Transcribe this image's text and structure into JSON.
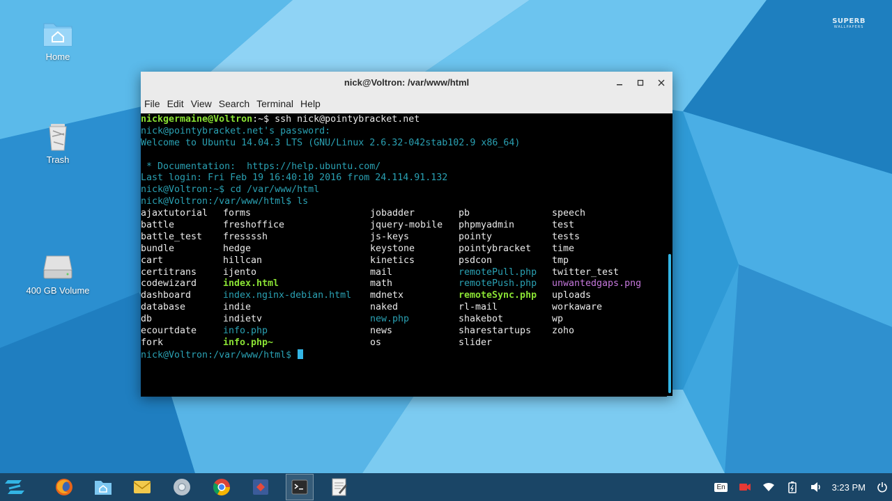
{
  "desktop": {
    "watermark": {
      "line1": "SUPERB",
      "line2": "WALLPAPERS"
    },
    "icons": [
      {
        "label": "Home",
        "icon": "home-folder-icon"
      },
      {
        "label": "Trash",
        "icon": "trash-icon"
      },
      {
        "label": "400 GB Volume",
        "icon": "drive-icon"
      }
    ]
  },
  "window": {
    "title": "nick@Voltron: /var/www/html",
    "menu": [
      "File",
      "Edit",
      "View",
      "Search",
      "Terminal",
      "Help"
    ]
  },
  "terminal": {
    "prompt1_user": "nickgermaine@Voltron",
    "prompt1_rest": ":~$ ssh nick@pointybracket.net",
    "line_password": "nick@pointybracket.net's password:",
    "line_welcome": "Welcome to Ubuntu 14.04.3 LTS (GNU/Linux 2.6.32-042stab102.9 x86_64)",
    "line_doc": " * Documentation:  https://help.ubuntu.com/",
    "line_lastlogin": "Last login: Fri Feb 19 16:40:10 2016 from 24.114.91.132",
    "line_cd": "nick@Voltron:~$ cd /var/www/html",
    "line_ls": "nick@Voltron:/var/www/html$ ls",
    "ls_columns": [
      [
        {
          "t": "ajaxtutorial",
          "c": "white"
        },
        {
          "t": "battle",
          "c": "white"
        },
        {
          "t": "battle_test",
          "c": "white"
        },
        {
          "t": "bundle",
          "c": "white"
        },
        {
          "t": "cart",
          "c": "white"
        },
        {
          "t": "certitrans",
          "c": "white"
        },
        {
          "t": "codewizard",
          "c": "white"
        },
        {
          "t": "dashboard",
          "c": "white"
        },
        {
          "t": "database",
          "c": "white"
        },
        {
          "t": "db",
          "c": "white"
        },
        {
          "t": "ecourtdate",
          "c": "white"
        },
        {
          "t": "fork",
          "c": "white"
        }
      ],
      [
        {
          "t": "forms",
          "c": "white"
        },
        {
          "t": "freshoffice",
          "c": "white"
        },
        {
          "t": "fressssh",
          "c": "white"
        },
        {
          "t": "hedge",
          "c": "white"
        },
        {
          "t": "hillcan",
          "c": "white"
        },
        {
          "t": "ijento",
          "c": "white"
        },
        {
          "t": "index.html",
          "c": "green-b"
        },
        {
          "t": "index.nginx-debian.html",
          "c": "cyan"
        },
        {
          "t": "indie",
          "c": "white"
        },
        {
          "t": "indietv",
          "c": "white"
        },
        {
          "t": "info.php",
          "c": "cyan"
        },
        {
          "t": "info.php~",
          "c": "green-b"
        }
      ],
      [
        {
          "t": "jobadder",
          "c": "white"
        },
        {
          "t": "jquery-mobile",
          "c": "white"
        },
        {
          "t": "js-keys",
          "c": "white"
        },
        {
          "t": "keystone",
          "c": "white"
        },
        {
          "t": "kinetics",
          "c": "white"
        },
        {
          "t": "mail",
          "c": "white"
        },
        {
          "t": "math",
          "c": "white"
        },
        {
          "t": "mdnetx",
          "c": "white"
        },
        {
          "t": "naked",
          "c": "white"
        },
        {
          "t": "new.php",
          "c": "cyan"
        },
        {
          "t": "news",
          "c": "white"
        },
        {
          "t": "os",
          "c": "white"
        }
      ],
      [
        {
          "t": "pb",
          "c": "white"
        },
        {
          "t": "phpmyadmin",
          "c": "white"
        },
        {
          "t": "pointy",
          "c": "white"
        },
        {
          "t": "pointybracket",
          "c": "white"
        },
        {
          "t": "psdcon",
          "c": "white"
        },
        {
          "t": "remotePull.php",
          "c": "cyan"
        },
        {
          "t": "remotePush.php",
          "c": "cyan"
        },
        {
          "t": "remoteSync.php",
          "c": "green-b"
        },
        {
          "t": "rl-mail",
          "c": "white"
        },
        {
          "t": "shakebot",
          "c": "white"
        },
        {
          "t": "sharestartups",
          "c": "white"
        },
        {
          "t": "slider",
          "c": "white"
        }
      ],
      [
        {
          "t": "speech",
          "c": "white"
        },
        {
          "t": "test",
          "c": "white"
        },
        {
          "t": "tests",
          "c": "white"
        },
        {
          "t": "time",
          "c": "white"
        },
        {
          "t": "tmp",
          "c": "white"
        },
        {
          "t": "twitter_test",
          "c": "white"
        },
        {
          "t": "unwantedgaps.png",
          "c": "magenta"
        },
        {
          "t": "uploads",
          "c": "white"
        },
        {
          "t": "workaware",
          "c": "white"
        },
        {
          "t": "wp",
          "c": "white"
        },
        {
          "t": "zoho",
          "c": "white"
        }
      ]
    ],
    "final_prompt": "nick@Voltron:/var/www/html$ "
  },
  "taskbar": {
    "apps": [
      "zorin-menu-icon",
      "firefox-icon",
      "files-icon",
      "mail-icon",
      "chromium-icon",
      "chrome-icon",
      "app-icon",
      "terminal-icon",
      "text-editor-icon"
    ],
    "tray": {
      "keyboard_layout": "En",
      "clock": "3:23 PM"
    }
  },
  "colors": {
    "terminal_bg": "#000000",
    "cursor": "#33b5e5",
    "green": "#8ae234",
    "cyan": "#2aa1b3",
    "magenta": "#c678dd"
  }
}
